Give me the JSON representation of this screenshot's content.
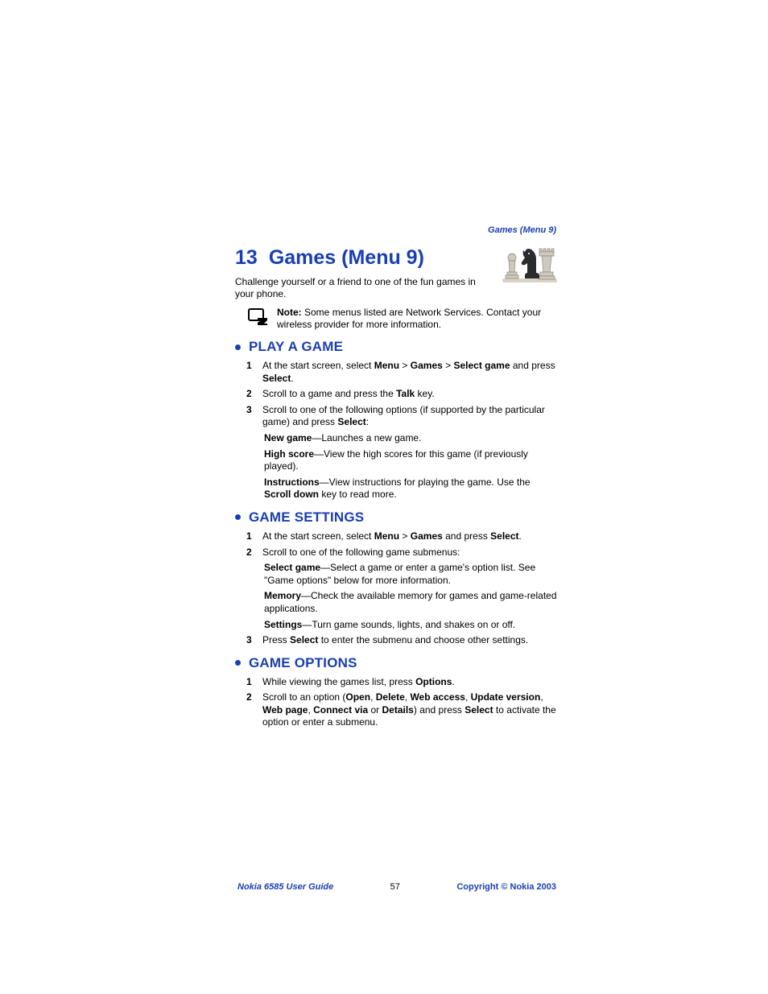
{
  "header_tag": "Games (Menu 9)",
  "chapter": {
    "num": "13",
    "title": "Games (Menu 9)"
  },
  "intro": "Challenge yourself or a friend to one of the fun games in your phone.",
  "note": {
    "label": "Note:",
    "body": " Some menus listed are Network Services. Contact your wireless provider for more information."
  },
  "sections": {
    "play": {
      "title": "PLAY A GAME",
      "s1": {
        "num": "1",
        "pre": "At the start screen, select ",
        "b1": "Menu",
        "sep1": " > ",
        "b2": "Games",
        "sep2": " > ",
        "b3": "Select game",
        "mid": " and press ",
        "b4": "Select",
        "post": "."
      },
      "s2": {
        "num": "2",
        "pre": "Scroll to a game and press the ",
        "b1": "Talk",
        "post": " key."
      },
      "s3": {
        "num": "3",
        "pre": "Scroll to one of the following options (if supported by the particular game) and press ",
        "b1": "Select",
        "post": ":"
      },
      "opt1": {
        "b": "New game",
        "t": "—Launches a new game."
      },
      "opt2": {
        "b": "High score",
        "t": "—View the high scores for this game (if previously played)."
      },
      "opt3": {
        "b": "Instructions",
        "t1": "—View instructions for playing the game. Use the ",
        "b2": "Scroll down",
        "t2": " key to read more."
      }
    },
    "settings": {
      "title": "GAME SETTINGS",
      "s1": {
        "num": "1",
        "pre": "At the start screen, select ",
        "b1": "Menu",
        "sep1": " > ",
        "b2": "Games",
        "mid": " and press ",
        "b3": "Select",
        "post": "."
      },
      "s2": {
        "num": "2",
        "pre": "Scroll to one of the following game submenus:"
      },
      "opt1": {
        "b": "Select game",
        "t": "—Select a game or enter a game's option list. See \"Game options\" below for more information."
      },
      "opt2": {
        "b": "Memory",
        "t": "—Check the available memory for games and game-related applications."
      },
      "opt3": {
        "b": "Settings",
        "t": "—Turn game sounds, lights, and shakes on or off."
      },
      "s3": {
        "num": "3",
        "pre": "Press ",
        "b1": "Select",
        "post": " to enter the submenu and choose other settings."
      }
    },
    "options": {
      "title": "GAME OPTIONS",
      "s1": {
        "num": "1",
        "pre": "While viewing the games list, press ",
        "b1": "Options",
        "post": "."
      },
      "s2": {
        "num": "2",
        "pre": "Scroll to an option (",
        "b1": "Open",
        "c1": ", ",
        "b2": "Delete",
        "c2": ", ",
        "b3": "Web access",
        "c3": ", ",
        "b4": "Update version",
        "c4": ", ",
        "b5": "Web page",
        "c5": ", ",
        "b6": "Connect via",
        "c6": " or ",
        "b7": "Details",
        "mid": ") and press ",
        "b8": "Select",
        "post": " to activate the option or enter a submenu."
      }
    }
  },
  "footer": {
    "left": "Nokia 6585 User Guide",
    "center": "57",
    "right_pre": "Copyright ",
    "right_sym": "©",
    "right_post": " Nokia 2003"
  }
}
